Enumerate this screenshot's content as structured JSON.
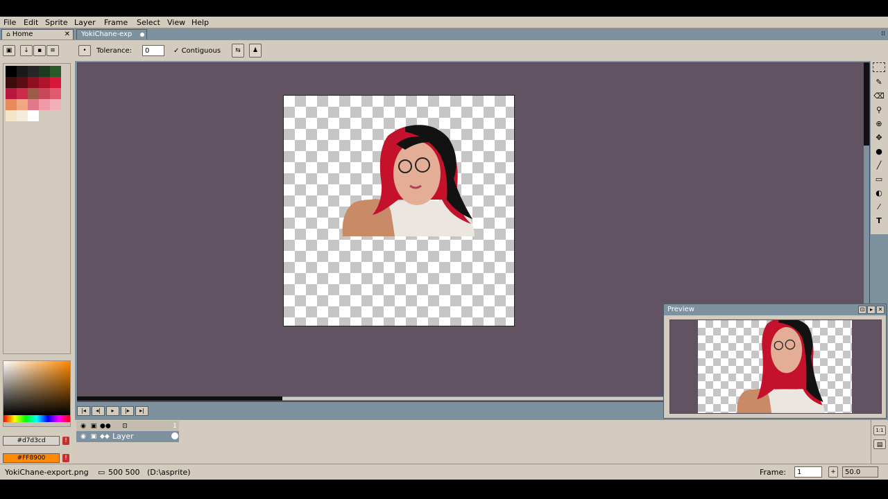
{
  "menu": {
    "file": "File",
    "edit": "Edit",
    "sprite": "Sprite",
    "layer": "Layer",
    "frame": "Frame",
    "select": "Select",
    "view": "View",
    "help": "Help"
  },
  "tabs": [
    {
      "label": "Home",
      "icon": "home-icon",
      "closable": true
    },
    {
      "label": "YokiChane-exp",
      "modified": true
    }
  ],
  "context_bar": {
    "tolerance_label": "Tolerance:",
    "tolerance_value": "0",
    "contiguous_label": "Contiguous",
    "contiguous_checked": true
  },
  "palette": {
    "colors": [
      "#000000",
      "#191919",
      "#262626",
      "#1e3a1e",
      "#2a5a2a",
      "#3a0c0c",
      "#5a0e14",
      "#8e1020",
      "#b0142a",
      "#d8183a",
      "#b81840",
      "#cc2a4a",
      "#a05a48",
      "#c8485a",
      "#e05a70",
      "#e88a5a",
      "#f0a882",
      "#e07a88",
      "#f09aa6",
      "#f4b0b8",
      "#f4e4c8",
      "#f6ecdc",
      "#ffffff"
    ]
  },
  "colors": {
    "foreground": "#d7d3cd",
    "background": "#ff8900",
    "foreground_label": "#d7d3cd",
    "background_label": "#FF8900"
  },
  "status": {
    "filename": "YokiChane-export.png",
    "size": "500 500",
    "path": "(D:\\asprite)",
    "frame_label": "Frame:",
    "frame_value": "1",
    "zoom_value": "50.0"
  },
  "preview": {
    "title": "Preview"
  },
  "layers": [
    {
      "name": "Layer",
      "frame_number": "1"
    }
  ],
  "toolbar_icons": [
    "marquee-icon",
    "pencil-icon",
    "eraser-icon",
    "eyedropper-icon",
    "zoom-icon",
    "move-icon",
    "fill-icon",
    "line-icon",
    "rectangle-icon",
    "blur-icon",
    "spray-icon",
    "text-icon"
  ],
  "tl_right_icons": {
    "zoom_one": "1:1"
  }
}
